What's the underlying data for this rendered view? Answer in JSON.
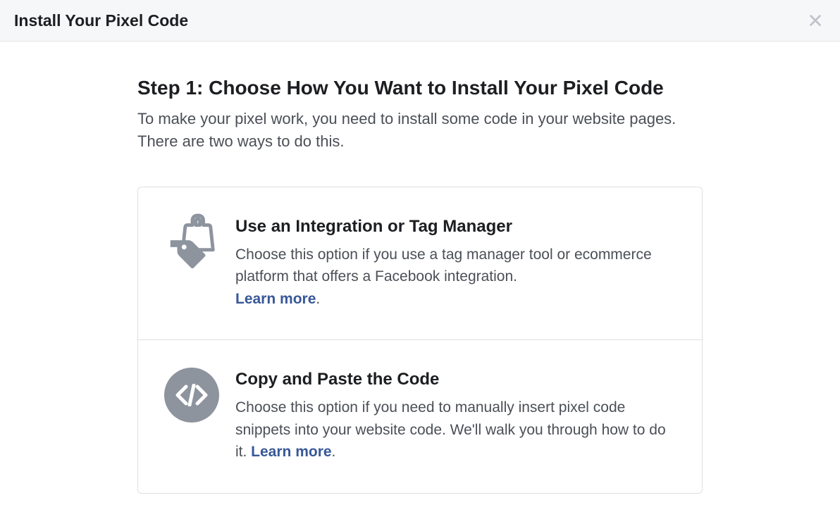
{
  "header": {
    "title": "Install Your Pixel Code"
  },
  "step": {
    "title": "Step 1: Choose How You Want to Install Your Pixel Code",
    "description": "To make your pixel work, you need to install some code in your website pages. There are two ways to do this."
  },
  "options": {
    "integration": {
      "title": "Use an Integration or Tag Manager",
      "description": "Choose this option if you use a tag manager tool or ecommerce platform that offers a Facebook integration. ",
      "learn_more_label": "Learn more",
      "period": "."
    },
    "manual": {
      "title": "Copy and Paste the Code",
      "description": "Choose this option if you need to manually insert pixel code snippets into your website code. We'll walk you through how to do it. ",
      "learn_more_label": "Learn more",
      "period": "."
    }
  }
}
